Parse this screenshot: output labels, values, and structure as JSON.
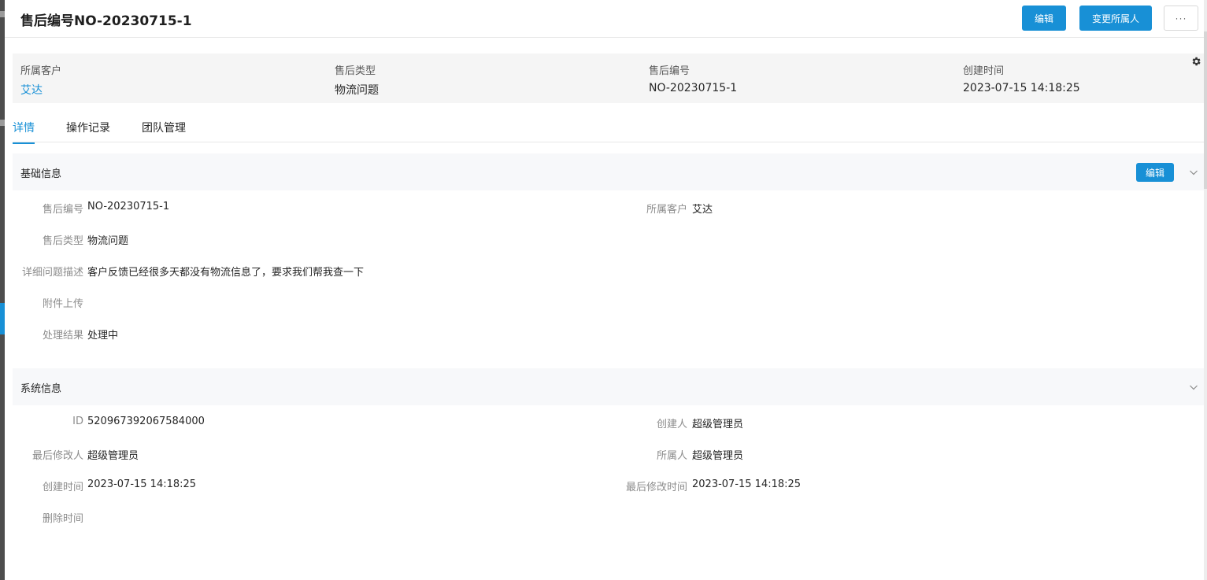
{
  "header": {
    "title": "售后编号NO-20230715-1",
    "edit_label": "编辑",
    "change_owner_label": "变更所属人",
    "more_label": "···"
  },
  "summary": {
    "customer": {
      "label": "所属客户",
      "value": "艾达"
    },
    "type": {
      "label": "售后类型",
      "value": "物流问题"
    },
    "number": {
      "label": "售后编号",
      "value": "NO-20230715-1"
    },
    "created": {
      "label": "创建时间",
      "value": "2023-07-15 14:18:25"
    }
  },
  "tabs": [
    {
      "label": "详情",
      "active": true
    },
    {
      "label": "操作记录",
      "active": false
    },
    {
      "label": "团队管理",
      "active": false
    }
  ],
  "basic": {
    "title": "基础信息",
    "edit_label": "编辑",
    "number": {
      "label": "售后编号",
      "value": "NO-20230715-1"
    },
    "customer": {
      "label": "所属客户",
      "value": "艾达"
    },
    "type": {
      "label": "售后类型",
      "value": "物流问题"
    },
    "description": {
      "label": "详细问题描述",
      "value": "客户反馈已经很多天都没有物流信息了，要求我们帮我查一下"
    },
    "attachment": {
      "label": "附件上传",
      "value": ""
    },
    "result": {
      "label": "处理结果",
      "value": "处理中"
    }
  },
  "system": {
    "title": "系统信息",
    "id": {
      "label": "ID",
      "value": "520967392067584000"
    },
    "creator": {
      "label": "创建人",
      "value": "超级管理员"
    },
    "last_modifier": {
      "label": "最后修改人",
      "value": "超级管理员"
    },
    "owner": {
      "label": "所属人",
      "value": "超级管理员"
    },
    "created": {
      "label": "创建时间",
      "value": "2023-07-15 14:18:25"
    },
    "modified": {
      "label": "最后修改时间",
      "value": "2023-07-15 14:18:25"
    },
    "deleted": {
      "label": "删除时间",
      "value": ""
    }
  },
  "icons": {
    "settings": "gear-icon",
    "collapse": "chevron-down-icon"
  },
  "colors": {
    "primary": "#1890d6",
    "summary_bg": "#f5f5f5",
    "section_bg": "#f7f8fa",
    "label": "#8c8c8c"
  }
}
